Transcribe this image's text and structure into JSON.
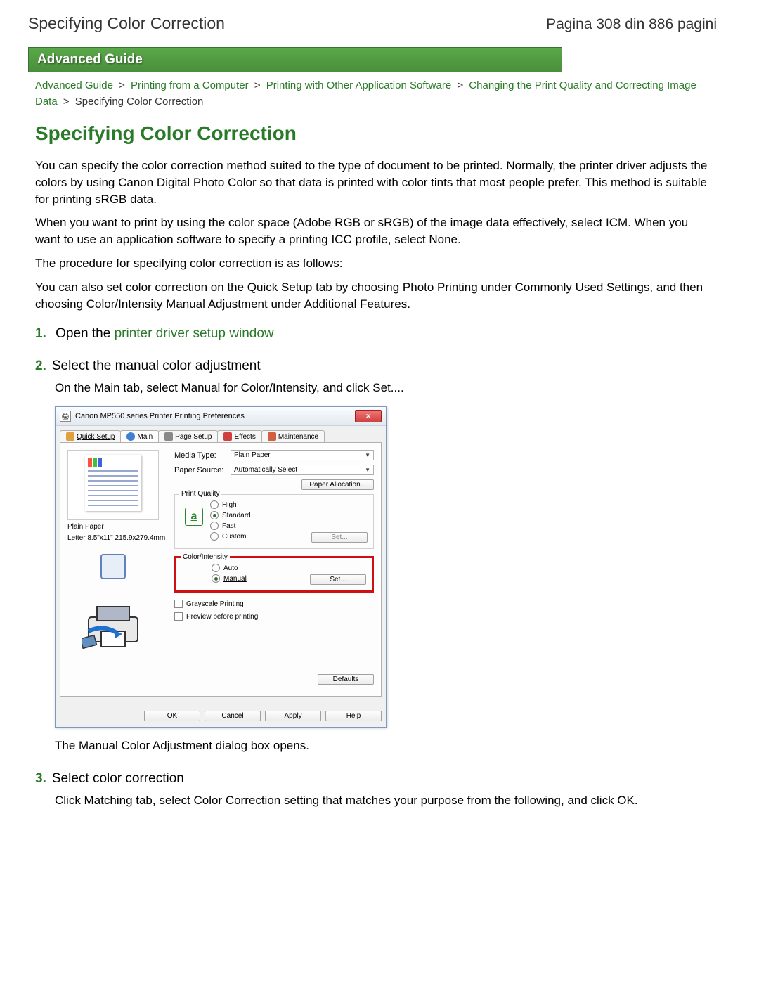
{
  "header": {
    "title": "Specifying Color Correction",
    "page_indicator": "Pagina 308 din 886 pagini"
  },
  "guide_bar": "Advanced Guide",
  "breadcrumb": {
    "items": [
      "Advanced Guide",
      "Printing from a Computer",
      "Printing with Other Application Software",
      "Changing the Print Quality and Correcting Image Data"
    ],
    "current": "Specifying Color Correction",
    "sep": ">"
  },
  "content": {
    "title": "Specifying Color Correction",
    "p1": "You can specify the color correction method suited to the type of document to be printed. Normally, the printer driver adjusts the colors by using Canon Digital Photo Color so that data is printed with color tints that most people prefer. This method is suitable for printing sRGB data.",
    "p2": "When you want to print by using the color space (Adobe RGB or sRGB) of the image data effectively, select ICM. When you want to use an application software to specify a printing ICC profile, select None.",
    "p3": "The procedure for specifying color correction is as follows:",
    "p4": "You can also set color correction on the Quick Setup tab by choosing Photo Printing under Commonly Used Settings, and then choosing Color/Intensity Manual Adjustment under Additional Features."
  },
  "steps": {
    "s1": {
      "prefix": "Open the ",
      "link": "printer driver setup window"
    },
    "s2": {
      "head": "Select the manual color adjustment",
      "body": "On the Main tab, select Manual for Color/Intensity, and click Set....",
      "after": "The Manual Color Adjustment dialog box opens."
    },
    "s3": {
      "head": "Select color correction",
      "body": "Click Matching tab, select Color Correction setting that matches your purpose from the following, and click OK."
    }
  },
  "dialog": {
    "title": "Canon MP550 series Printer Printing Preferences",
    "tabs": [
      "Quick Setup",
      "Main",
      "Page Setup",
      "Effects",
      "Maintenance"
    ],
    "media_type_label": "Media Type:",
    "media_type_value": "Plain Paper",
    "paper_source_label": "Paper Source:",
    "paper_source_value": "Automatically Select",
    "paper_allocation": "Paper Allocation...",
    "quality_legend": "Print Quality",
    "quality_high": "High",
    "quality_standard": "Standard",
    "quality_fast": "Fast",
    "quality_custom": "Custom",
    "quality_set": "Set...",
    "color_legend": "Color/Intensity",
    "color_auto": "Auto",
    "color_manual": "Manual",
    "color_set": "Set...",
    "grayscale": "Grayscale Printing",
    "preview": "Preview before printing",
    "defaults": "Defaults",
    "ok": "OK",
    "cancel": "Cancel",
    "apply": "Apply",
    "help": "Help",
    "preview_caption1": "Plain Paper",
    "preview_caption2": "Letter 8.5\"x11\" 215.9x279.4mm",
    "a_icon": "a"
  }
}
